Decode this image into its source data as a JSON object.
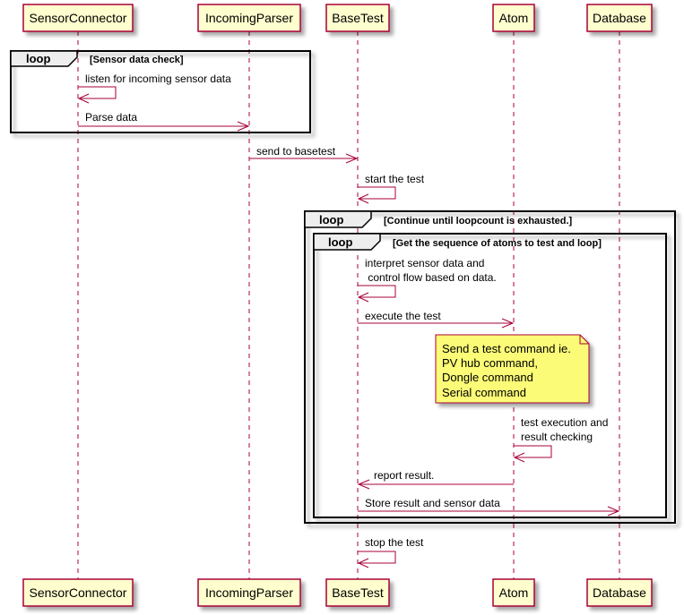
{
  "diagram": {
    "type": "sequence",
    "participants": [
      {
        "id": "sc",
        "label": "SensorConnector"
      },
      {
        "id": "ip",
        "label": "IncomingParser"
      },
      {
        "id": "bt",
        "label": "BaseTest"
      },
      {
        "id": "at",
        "label": "Atom"
      },
      {
        "id": "db",
        "label": "Database"
      }
    ],
    "loops": [
      {
        "keyword": "loop",
        "condition": "[Sensor data check]"
      },
      {
        "keyword": "loop",
        "condition": "[Continue until loopcount is exhausted.]"
      },
      {
        "keyword": "loop",
        "condition": "[Get the sequence of atoms to test and loop]"
      }
    ],
    "messages": [
      {
        "from": "sc",
        "to": "sc",
        "lines": [
          "listen for incoming sensor data"
        ]
      },
      {
        "from": "sc",
        "to": "ip",
        "lines": [
          "Parse data"
        ]
      },
      {
        "from": "ip",
        "to": "bt",
        "lines": [
          "send to basetest"
        ]
      },
      {
        "from": "bt",
        "to": "bt",
        "lines": [
          "start the test"
        ]
      },
      {
        "from": "bt",
        "to": "bt",
        "lines": [
          "interpret sensor data and",
          " control flow based on data."
        ]
      },
      {
        "from": "bt",
        "to": "at",
        "lines": [
          "execute the test"
        ]
      },
      {
        "from": "at",
        "to": "at",
        "lines": [
          "test execution and",
          "result checking"
        ]
      },
      {
        "from": "at",
        "to": "bt",
        "lines": [
          "report result."
        ]
      },
      {
        "from": "bt",
        "to": "db",
        "lines": [
          "Store result and sensor data"
        ]
      },
      {
        "from": "bt",
        "to": "bt",
        "lines": [
          "stop the test"
        ]
      }
    ],
    "note": {
      "over": "at",
      "lines": [
        "Send a test command ie.",
        "PV hub command,",
        "Dongle command",
        "Serial command"
      ]
    }
  },
  "colors": {
    "participant_fill": "#FEFECE",
    "participant_border": "#A80036",
    "arrow": "#A80036",
    "note_fill": "#FBFB77",
    "note_border": "#A80036",
    "loop_header_fill": "#EEEEEE"
  }
}
